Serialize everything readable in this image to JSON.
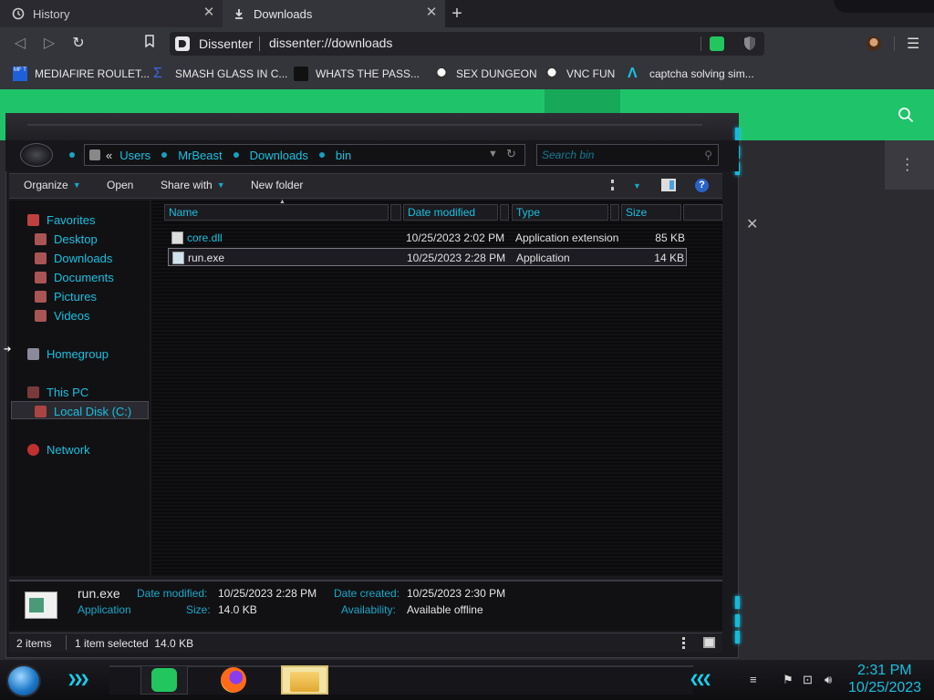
{
  "browser": {
    "tabs": [
      {
        "label": "History",
        "icon": "history-icon"
      },
      {
        "label": "Downloads",
        "icon": "download-icon"
      }
    ],
    "omnibox": {
      "site": "Dissenter",
      "url": "dissenter://downloads"
    },
    "bookmarks": [
      {
        "label": "MEDIAFIRE ROULET...",
        "icon": "mediafire-icon",
        "color": "#1f5fd8"
      },
      {
        "label": "SMASH GLASS IN C...",
        "icon": "smash-icon",
        "color": "#2a5ad8"
      },
      {
        "label": "WHATS THE PASS...",
        "icon": "hat-icon",
        "color": "#444444"
      },
      {
        "label": "SEX DUNGEON",
        "icon": "ghost-icon",
        "color": "#dddddd"
      },
      {
        "label": "VNC FUN",
        "icon": "ghost2-icon",
        "color": "#dddddd"
      },
      {
        "label": "captcha solving sim...",
        "icon": "a-logo-icon",
        "color": "#18c0e0"
      }
    ]
  },
  "explorer": {
    "breadcrumb": [
      "Users",
      "MrBeast",
      "Downloads",
      "bin"
    ],
    "search_placeholder": "Search bin",
    "toolbar": {
      "organize": "Organize",
      "open": "Open",
      "share": "Share with",
      "new_folder": "New folder"
    },
    "nav": {
      "favorites": "Favorites",
      "desktop": "Desktop",
      "downloads": "Downloads",
      "documents": "Documents",
      "pictures": "Pictures",
      "videos": "Videos",
      "homegroup": "Homegroup",
      "thispc": "This PC",
      "localdisk": "Local Disk (C:)",
      "network": "Network"
    },
    "columns": {
      "name": "Name",
      "date": "Date modified",
      "type": "Type",
      "size": "Size"
    },
    "files": [
      {
        "name": "core.dll",
        "date": "10/25/2023 2:02 PM",
        "type": "Application extension",
        "size": "85 KB"
      },
      {
        "name": "run.exe",
        "date": "10/25/2023 2:28 PM",
        "type": "Application",
        "size": "14 KB"
      }
    ],
    "details": {
      "name": "run.exe",
      "kind": "Application",
      "date_modified_label": "Date modified:",
      "date_modified": "10/25/2023 2:28 PM",
      "size_label": "Size:",
      "size": "14.0 KB",
      "date_created_label": "Date created:",
      "date_created": "10/25/2023 2:30 PM",
      "availability_label": "Availability:",
      "availability": "Available offline"
    },
    "status": {
      "items": "2 items",
      "selected": "1 item selected  14.0 KB"
    }
  },
  "taskbar": {
    "time": "2:31 PM",
    "date": "10/25/2023"
  },
  "colors": {
    "accent_cyan": "#18c0e0",
    "brand_green": "#1fc46a"
  }
}
